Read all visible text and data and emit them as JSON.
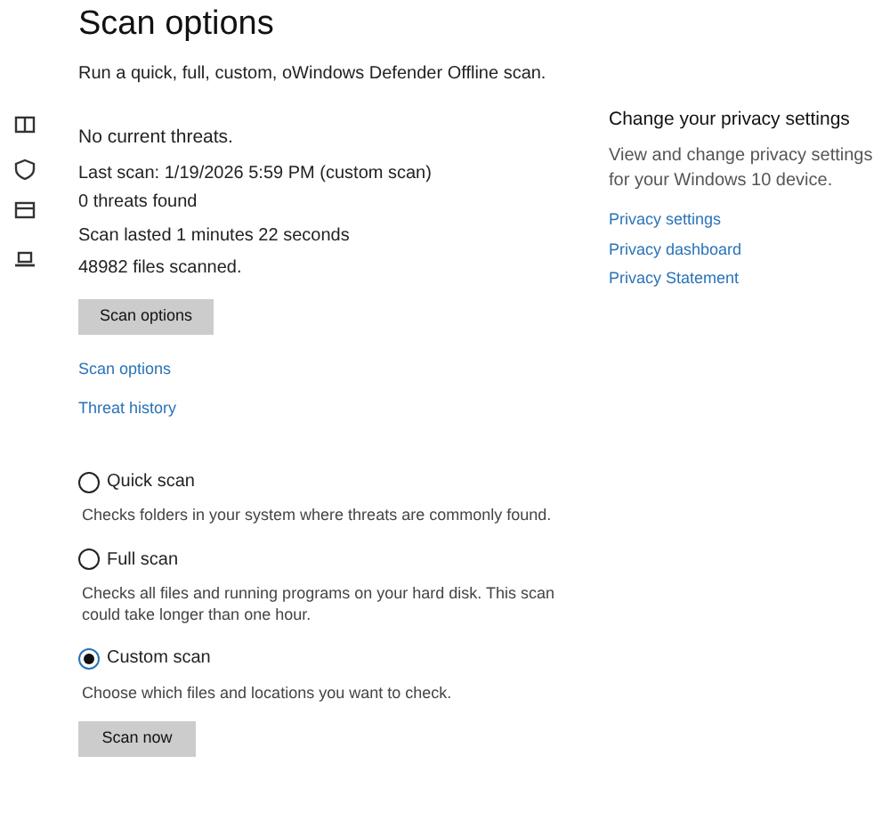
{
  "page": {
    "title": "Scan options",
    "subtitle": "Run a quick, full, custom, oWindows Defender Offline scan."
  },
  "status": {
    "headline": "No current threats.",
    "last_scan": "Last scan: 1/19/2026 5:59 PM (custom scan)",
    "threats_found": "0 threats found",
    "duration": "Scan lasted 1 minutes 22 seconds",
    "files": "48982 files scanned."
  },
  "scan_options_button": "Scan options",
  "links": [
    "Scan options",
    "Threat history"
  ],
  "scan_types": [
    {
      "label": "Quick scan",
      "description": "Checks folders in your system where threats are commonly found.",
      "selected": false
    },
    {
      "label": "Full scan",
      "description": "Checks all files and running programs on your hard disk. This scan could take longer than one hour.",
      "selected": false
    },
    {
      "label": "Custom scan",
      "description": "Choose which files and locations you want to check.",
      "selected": true
    }
  ],
  "scan_now_button": "Scan now",
  "privacy": {
    "title": "Change your privacy settings",
    "text": "View and change privacy settings for your Windows 10 device.",
    "links": [
      "Privacy settings",
      "Privacy dashboard",
      "Privacy Statement"
    ]
  }
}
